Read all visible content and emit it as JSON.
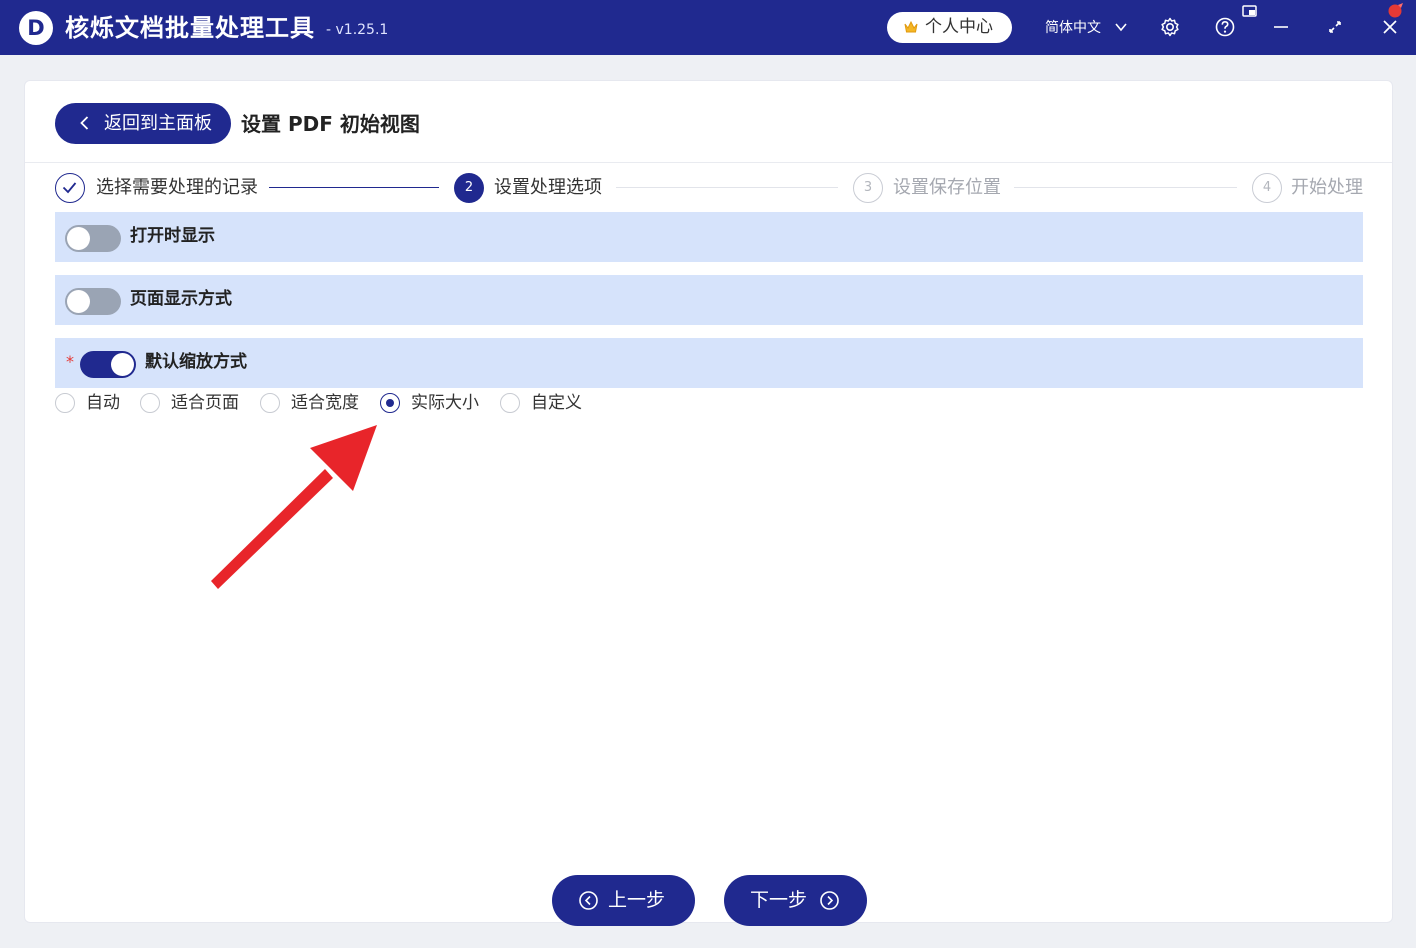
{
  "app": {
    "logo_letter": "D",
    "title": "核烁文档批量处理工具",
    "version": "- v1.25.1",
    "account_label": "个人中心",
    "language": "简体中文",
    "colors": {
      "primary": "#20298f",
      "row_bg": "#d6e3fb",
      "annotation_arrow": "#e8252a"
    }
  },
  "header": {
    "back_label": "返回到主面板",
    "page_title": "设置 PDF 初始视图"
  },
  "steps": [
    {
      "num": "1",
      "label": "选择需要处理的记录",
      "state": "done"
    },
    {
      "num": "2",
      "label": "设置处理选项",
      "state": "active"
    },
    {
      "num": "3",
      "label": "设置保存位置",
      "state": "todo"
    },
    {
      "num": "4",
      "label": "开始处理",
      "state": "todo"
    }
  ],
  "options": [
    {
      "label": "打开时显示",
      "enabled": false,
      "required": false
    },
    {
      "label": "页面显示方式",
      "enabled": false,
      "required": false
    },
    {
      "label": "默认缩放方式",
      "enabled": true,
      "required": true,
      "required_mark": "*"
    }
  ],
  "zoom_radios": {
    "selected": "实际大小",
    "items": [
      "自动",
      "适合页面",
      "适合宽度",
      "实际大小",
      "自定义"
    ]
  },
  "footer": {
    "prev_label": "上一步",
    "next_label": "下一步"
  },
  "icons": [
    "settings-icon",
    "help-icon",
    "mini-window-icon",
    "minimize-icon",
    "maximize-icon",
    "close-icon"
  ]
}
